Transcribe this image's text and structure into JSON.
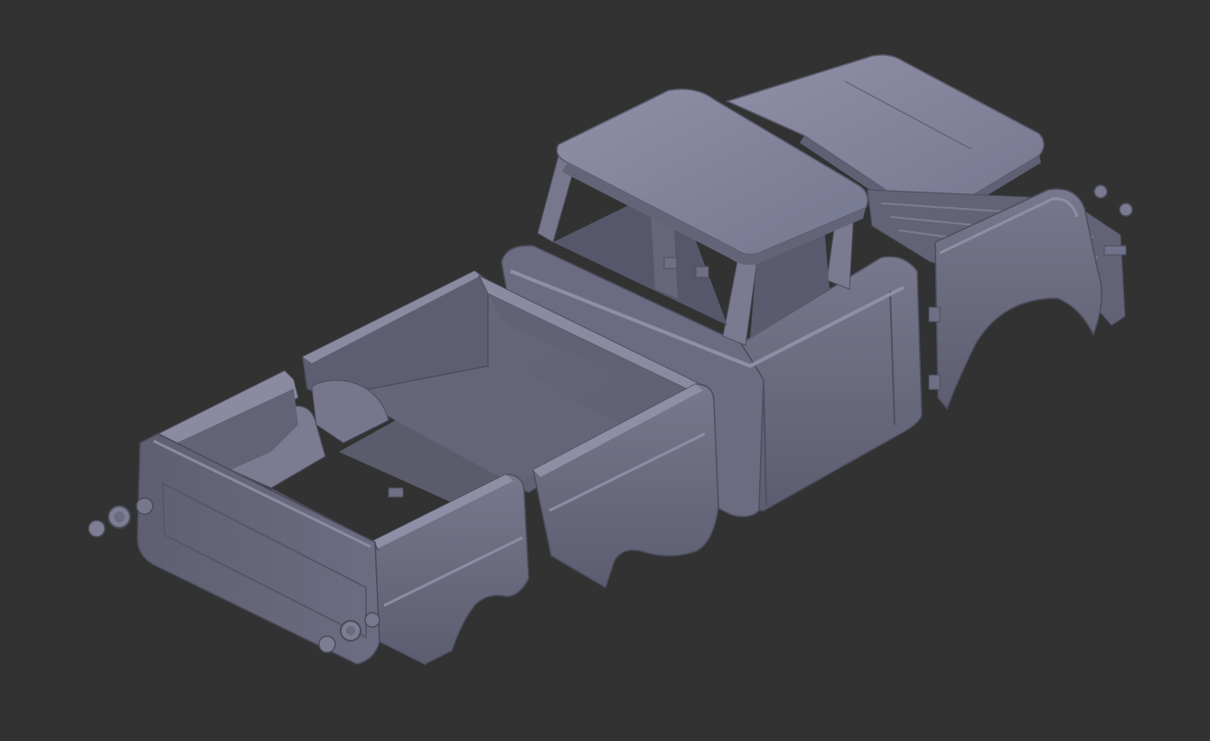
{
  "viewport": {
    "background": "#323232"
  },
  "model": {
    "subject": "truck-body-shell",
    "material_color": "#6e6f84",
    "highlight_color": "#8d8ea4",
    "shadow_color": "#4e4f60",
    "dark_color": "#3a3b47"
  }
}
